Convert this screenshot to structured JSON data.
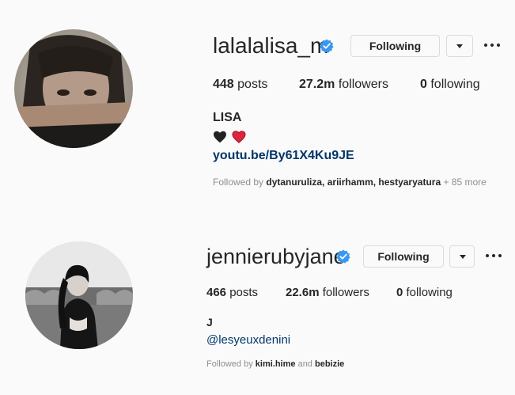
{
  "profiles": [
    {
      "username": "lalalalisa_m",
      "follow_label": "Following",
      "posts_count": "448",
      "posts_label": "posts",
      "followers_count": "27.2m",
      "followers_label": "followers",
      "following_count": "0",
      "following_label": "following",
      "full_name": "LISA",
      "bio_emoji": "🖤❤️",
      "link": "youtu.be/By61X4Ku9JE",
      "followed_by_prefix": "Followed by",
      "followed_by_users": "dytanuruliza, ariirhamm, hestyaryatura",
      "followed_by_more": " + 85 more"
    },
    {
      "username": "jennierubyjane",
      "follow_label": "Following",
      "posts_count": "466",
      "posts_label": "posts",
      "followers_count": "22.6m",
      "followers_label": "followers",
      "following_count": "0",
      "following_label": "following",
      "full_name": "J",
      "link": "@lesyeuxdenini",
      "followed_by_prefix": "Followed by",
      "followed_by_user1": "kimi.hime",
      "followed_by_and": " and ",
      "followed_by_user2": "bebizie"
    }
  ],
  "colors": {
    "verified_blue": "#3897f0",
    "link_blue": "#003569",
    "muted_gray": "#8e8e8e",
    "border": "#dbdbdb"
  },
  "icons": [
    "verified-badge-icon",
    "chevron-down-icon",
    "more-options-icon",
    "black-heart-icon",
    "red-heart-icon"
  ]
}
